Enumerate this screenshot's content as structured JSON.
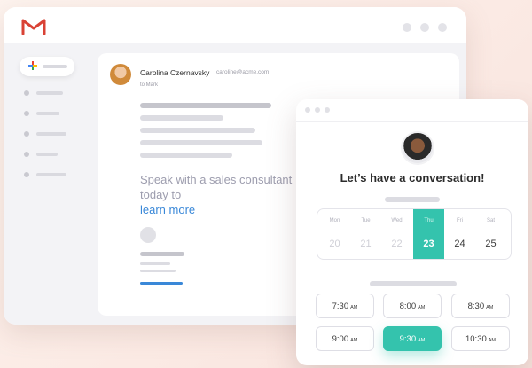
{
  "gmail": {
    "colors": {
      "logo_red": "#d94235",
      "compose_plus": [
        "#ea4335",
        "#fbbc05",
        "#34a853",
        "#4285f4"
      ]
    },
    "email": {
      "sender_name": "Carolina Czernavsky",
      "sender_email": "caroline@acme.com",
      "to": "to Mark",
      "message": "Speak with a sales consultant today to",
      "link": "learn more"
    }
  },
  "scheduler": {
    "title": "Let’s have a conversation!",
    "accent": "#34c3ad",
    "days": [
      {
        "name": "Mon",
        "date": "20"
      },
      {
        "name": "Tue",
        "date": "21"
      },
      {
        "name": "Wed",
        "date": "22"
      },
      {
        "name": "Thu",
        "date": "23"
      },
      {
        "name": "Fri",
        "date": "24"
      },
      {
        "name": "Sat",
        "date": "25"
      }
    ],
    "selected_day": "23",
    "times": [
      {
        "time": "7:30",
        "period": "AM"
      },
      {
        "time": "8:00",
        "period": "AM"
      },
      {
        "time": "8:30",
        "period": "AM"
      },
      {
        "time": "9:00",
        "period": "AM"
      },
      {
        "time": "9:30",
        "period": "AM"
      },
      {
        "time": "10:30",
        "period": "AM"
      }
    ],
    "selected_time": "9:30"
  }
}
